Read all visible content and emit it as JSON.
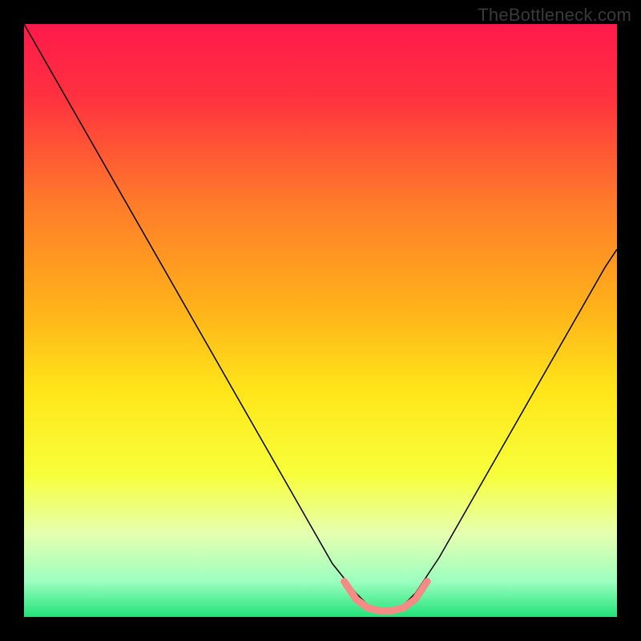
{
  "watermark": "TheBottleneck.com",
  "chart_data": {
    "type": "line",
    "title": "",
    "xlabel": "",
    "ylabel": "",
    "xlim": [
      0,
      100
    ],
    "ylim": [
      0,
      100
    ],
    "grid": false,
    "legend": false,
    "gradient_stops": [
      {
        "offset": 0,
        "color": "#ff1a4b"
      },
      {
        "offset": 12,
        "color": "#ff3040"
      },
      {
        "offset": 30,
        "color": "#ff7a2a"
      },
      {
        "offset": 48,
        "color": "#ffb21a"
      },
      {
        "offset": 62,
        "color": "#ffe61a"
      },
      {
        "offset": 76,
        "color": "#f7ff3a"
      },
      {
        "offset": 86,
        "color": "#e6ffb0"
      },
      {
        "offset": 94,
        "color": "#9cffc0"
      },
      {
        "offset": 100,
        "color": "#22e27a"
      }
    ],
    "series": [
      {
        "name": "curve",
        "stroke": "#000000",
        "stroke_width": 1.5,
        "x": [
          0,
          4,
          8,
          12,
          16,
          20,
          24,
          28,
          32,
          36,
          40,
          44,
          48,
          52,
          56,
          58,
          60,
          62,
          64,
          66,
          70,
          74,
          78,
          82,
          86,
          90,
          94,
          98,
          100
        ],
        "y": [
          100,
          93,
          86,
          79,
          72,
          65,
          58,
          51,
          44,
          37,
          30,
          23,
          16,
          9,
          4,
          2,
          1,
          1,
          2,
          4,
          10,
          17,
          24,
          31,
          38,
          45,
          52,
          59,
          62
        ]
      },
      {
        "name": "highlight-segment",
        "stroke": "#f58b84",
        "stroke_width": 9,
        "linecap": "round",
        "x": [
          54,
          56,
          58,
          60,
          62,
          64,
          66,
          68
        ],
        "y": [
          6,
          3,
          1.5,
          1,
          1,
          1.5,
          3,
          6
        ]
      }
    ]
  }
}
